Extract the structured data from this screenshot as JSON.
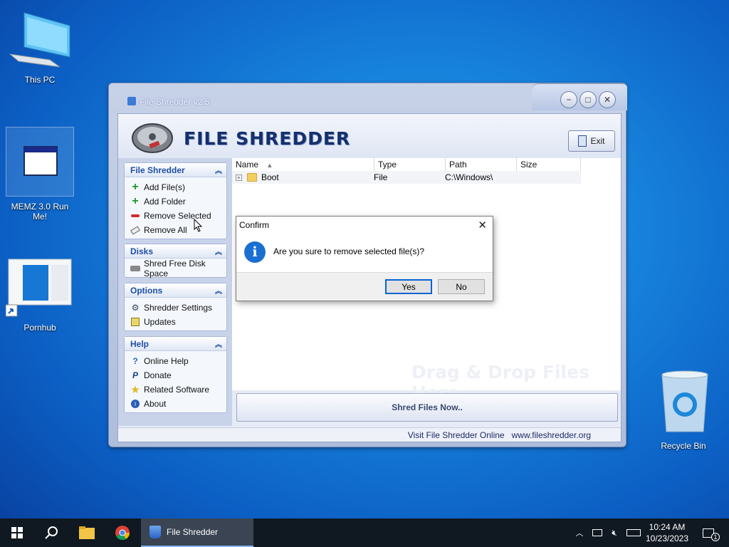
{
  "desktop": {
    "icons": [
      {
        "label": "This PC",
        "icon": "monitor-icon"
      },
      {
        "label": "MEMZ 3.0 Run Me!",
        "icon": "window-app-icon"
      },
      {
        "label": "Pornhub",
        "icon": "shortcut-thumbnail-icon"
      },
      {
        "label": "Recycle Bin",
        "icon": "recycle-bin-icon"
      }
    ]
  },
  "window": {
    "title": "File Shredder v2.5",
    "logo_text": "FILE SHREDDER",
    "exit_label": "Exit",
    "groups": [
      {
        "title": "File Shredder",
        "items": [
          {
            "label": "Add File(s)",
            "icon": "plus-icon"
          },
          {
            "label": "Add Folder",
            "icon": "plus-icon"
          },
          {
            "label": "Remove Selected",
            "icon": "minus-icon"
          },
          {
            "label": "Remove All",
            "icon": "eraser-icon"
          }
        ]
      },
      {
        "title": "Disks",
        "items": [
          {
            "label": "Shred Free Disk Space",
            "icon": "disk-icon"
          }
        ]
      },
      {
        "title": "Options",
        "items": [
          {
            "label": "Shredder Settings",
            "icon": "settings-icon"
          },
          {
            "label": "Updates",
            "icon": "updates-icon"
          }
        ]
      },
      {
        "title": "Help",
        "items": [
          {
            "label": "Online Help",
            "icon": "help-icon"
          },
          {
            "label": "Donate",
            "icon": "paypal-icon"
          },
          {
            "label": "Related Software",
            "icon": "star-icon"
          },
          {
            "label": "About",
            "icon": "info-icon"
          }
        ]
      }
    ],
    "file_list": {
      "columns": [
        "Name",
        "Type",
        "Path",
        "Size"
      ],
      "rows": [
        {
          "name": "Boot",
          "type": "File",
          "path": "C:\\Windows\\",
          "size": ""
        }
      ],
      "drop_hint": "Drag & Drop Files Here"
    },
    "shred_button": "Shred Files Now..",
    "status": {
      "link_text": "Visit File Shredder Online",
      "url_text": "www.fileshredder.org"
    }
  },
  "dialog": {
    "title": "Confirm",
    "message": "Are you sure to remove selected file(s)?",
    "yes_label": "Yes",
    "no_label": "No"
  },
  "taskbar": {
    "app_label": "File Shredder",
    "time": "10:24 AM",
    "date": "10/23/2023",
    "notification_count": "1"
  },
  "colors": {
    "accent": "#1d4fa5",
    "title_text": "#15306e",
    "taskbar": "#101821"
  }
}
